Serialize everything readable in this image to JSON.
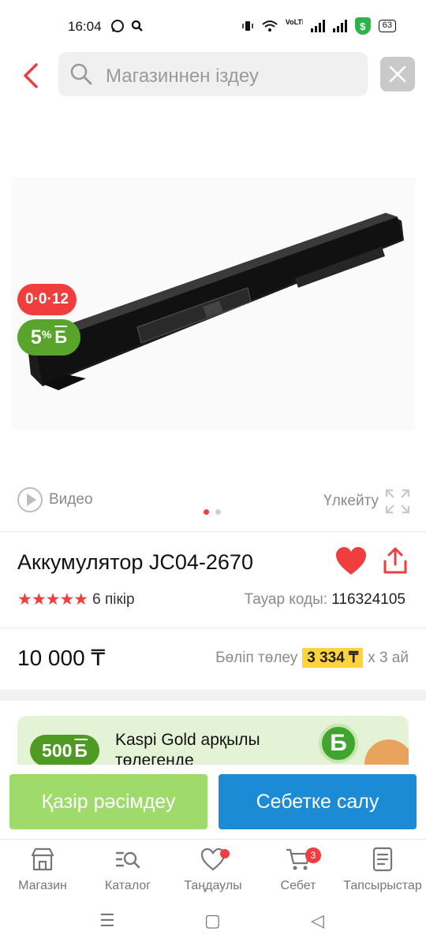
{
  "status_bar": {
    "time": "16:04",
    "battery": "63",
    "left_icons": [
      "whatsapp-icon",
      "search-icon"
    ],
    "right_icons": [
      "vibrate-icon",
      "wifi-icon",
      "volte-icon",
      "signal-icon",
      "signal-icon",
      "shield-icon",
      "battery-icon"
    ],
    "shield_label": "$",
    "volte_label": "VoLTE"
  },
  "header": {
    "search_placeholder": "Магазиннен іздеу"
  },
  "product": {
    "credit_badge": "0·0·12",
    "bonus_badge_percent": "5",
    "bonus_badge_symbol": "%",
    "bonus_badge_currency": "Б",
    "video_label": "Видео",
    "enlarge_label": "Үлкейту",
    "image_dots_total": 2,
    "image_dots_active": 1,
    "title": "Аккумулятор JC04-2670",
    "rating_stars": 5,
    "reviews": "6 пікір",
    "code_label": "Тауар коды:",
    "code_value": "116324105",
    "price": "10 000 ₸",
    "installment_label": "Бөліп төлеу",
    "installment_amount": "3 334 ₸",
    "installment_term": "x 3 ай"
  },
  "promo": {
    "badge_amount": "500",
    "badge_currency": "Б",
    "text_line1": "Kaspi Gold арқылы",
    "text_line2": "төлегенде",
    "logo_letter": "Б"
  },
  "actions": {
    "checkout_label": "Қазір рәсімдеу",
    "cart_label": "Себетке салу"
  },
  "bottom_nav": {
    "items": [
      {
        "label": "Магазин",
        "icon": "store-icon"
      },
      {
        "label": "Каталог",
        "icon": "catalog-icon"
      },
      {
        "label": "Таңдаулы",
        "icon": "heart-icon"
      },
      {
        "label": "Себет",
        "icon": "cart-icon",
        "count": "3"
      },
      {
        "label": "Тапсырыстар",
        "icon": "orders-icon"
      }
    ]
  },
  "colors": {
    "accent_red": "#f03e3e",
    "bonus_green": "#59a52c",
    "checkout_green": "#9edb6a",
    "cart_blue": "#1b8bd6",
    "installment_yellow": "#ffd43b"
  }
}
